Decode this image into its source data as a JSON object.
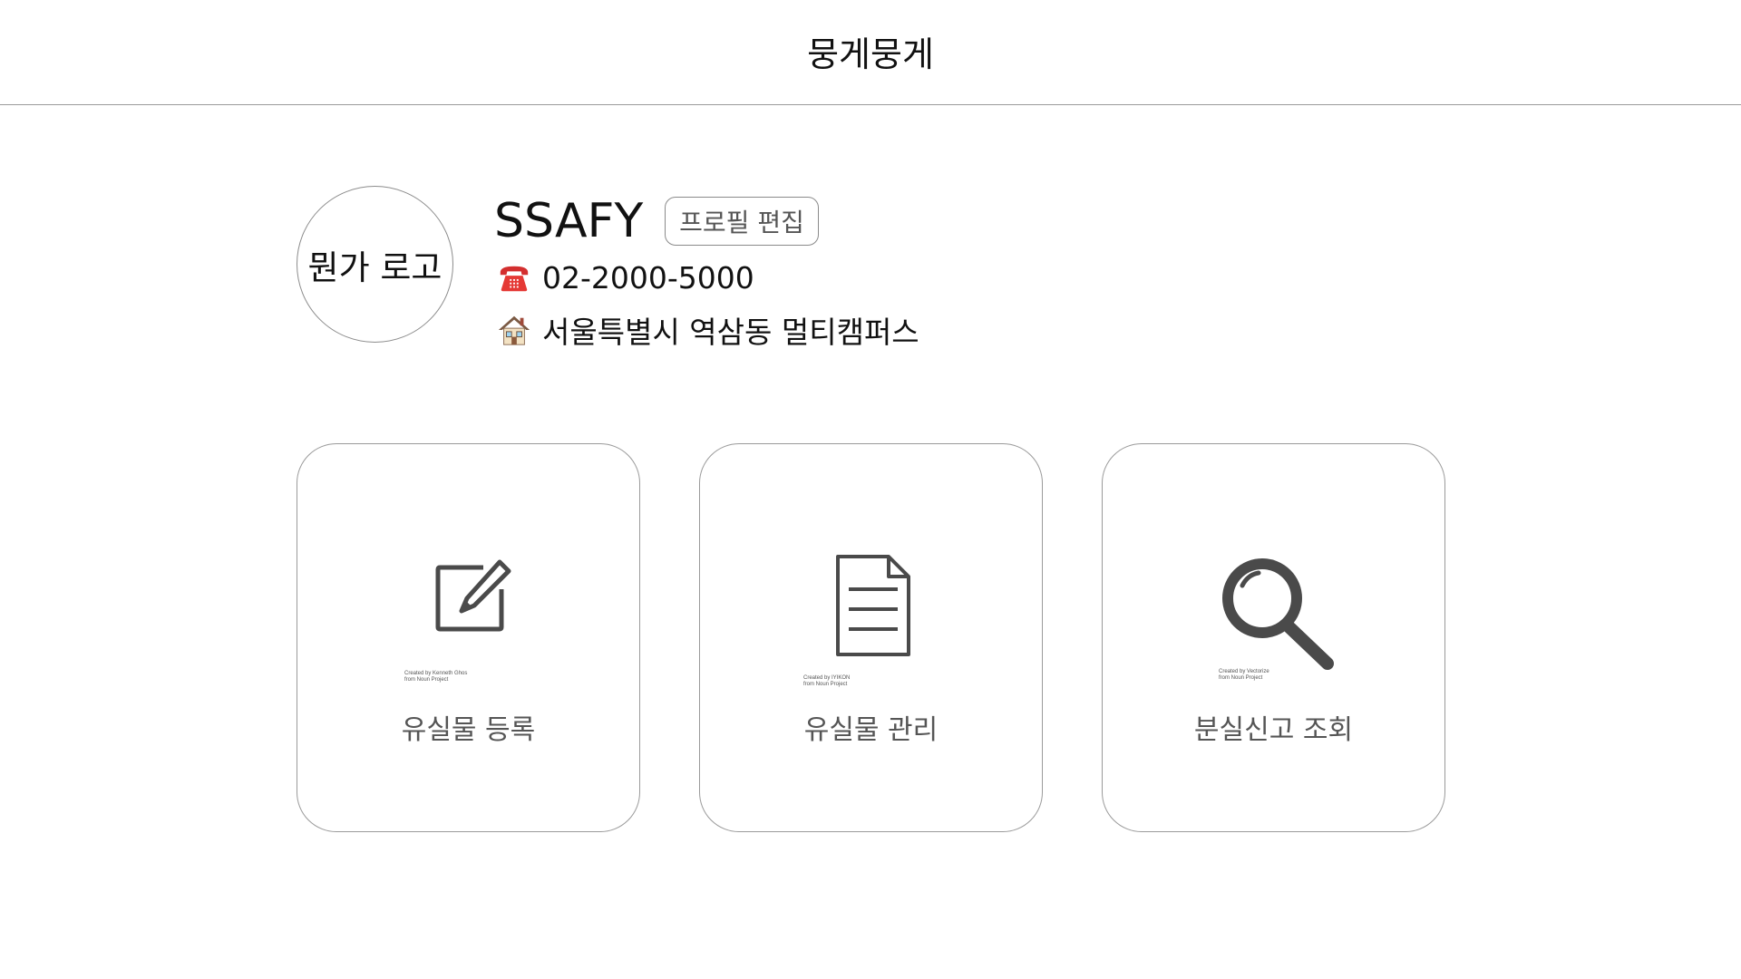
{
  "header": {
    "title": "뭉게뭉게"
  },
  "profile": {
    "logo_text": "뭔가 로고",
    "name": "SSAFY",
    "edit_button_label": "프로필 편집",
    "phone": "02-2000-5000",
    "phone_icon": "telephone-icon",
    "address": "서울특별시 역삼동 멀티캠퍼스",
    "address_icon": "house-icon"
  },
  "cards": [
    {
      "icon": "edit-note-icon",
      "credit_line1": "Created by Kenneth Ghos",
      "credit_line2": "from Noun Project",
      "label": "유실물 등록"
    },
    {
      "icon": "document-icon",
      "credit_line1": "Created by IYIKON",
      "credit_line2": "from Noun Project",
      "label": "유실물 관리"
    },
    {
      "icon": "magnifier-icon",
      "credit_line1": "Created by Vectorize",
      "credit_line2": "from Noun Project",
      "label": "분실신고 조회"
    }
  ]
}
